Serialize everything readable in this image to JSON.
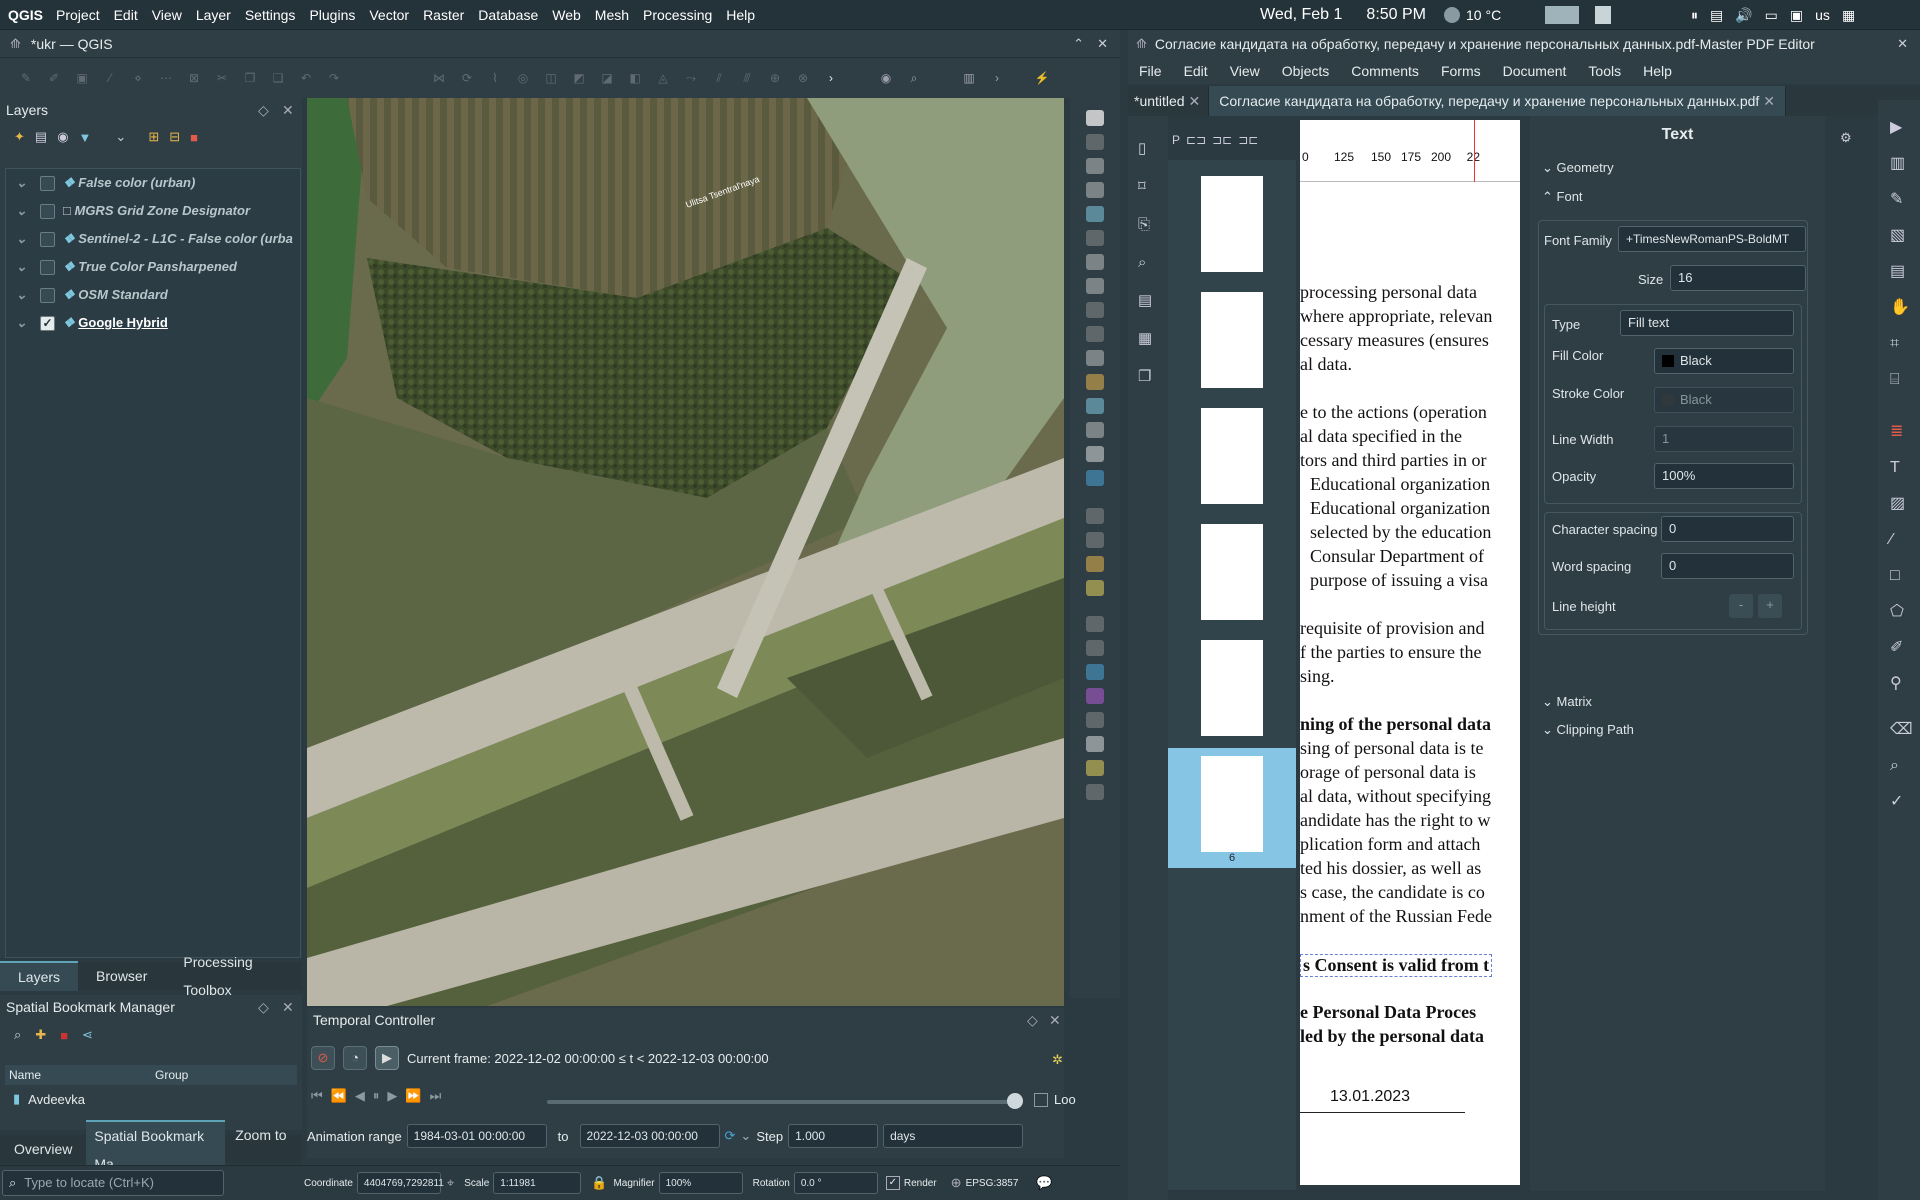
{
  "topbar": {
    "logo": "QGIS",
    "menu": [
      "Project",
      "Edit",
      "View",
      "Layer",
      "Settings",
      "Plugins",
      "Vector",
      "Raster",
      "Database",
      "Web",
      "Mesh",
      "Processing",
      "Help"
    ],
    "date": "Wed, Feb 1",
    "time": "8:50 PM",
    "temp": "10 °C",
    "kbd": "us"
  },
  "qgis": {
    "title": "*ukr — QGIS",
    "layers_title": "Layers",
    "layers": [
      {
        "name": "False color (urban)",
        "checked": false
      },
      {
        "name": "MGRS Grid Zone Designator",
        "checked": false
      },
      {
        "name": "Sentinel-2 - L1C - False color (urba",
        "checked": false
      },
      {
        "name": "True Color Pansharpened",
        "checked": false
      },
      {
        "name": "OSM Standard",
        "checked": false
      },
      {
        "name": "Google Hybrid",
        "checked": true
      }
    ],
    "dock_tabs": [
      "Layers",
      "Browser",
      "Processing Toolbox"
    ],
    "bookmarks_title": "Spatial Bookmark Manager",
    "bm_cols": [
      "Name",
      "Group"
    ],
    "bookmark": "Avdeevka",
    "bottom_tabs": [
      "Overview",
      "Spatial Bookmark Ma...",
      "Zoom to ..."
    ],
    "map_label": "Ulitsa Tsentral'naya",
    "temporal": {
      "title": "Temporal Controller",
      "frame": "Current frame: 2022-12-02 00:00:00 ≤ t < 2022-12-03 00:00:00",
      "range_label": "Animation range",
      "from": "1984-03-01 00:00:00",
      "to_label": "to",
      "to": "2022-12-03 00:00:00",
      "step_label": "Step",
      "step": "1.000",
      "unit": "days",
      "loop": "Loo"
    },
    "status": {
      "locate_placeholder": "Type to locate (Ctrl+K)",
      "coord_label": "Coordinate",
      "coord": "4404769,7292811",
      "scale_label": "Scale",
      "scale": "1:11981",
      "mag_label": "Magnifier",
      "mag": "100%",
      "rot_label": "Rotation",
      "rot": "0.0 °",
      "render": "Render",
      "epsg": "EPSG:3857"
    }
  },
  "pdf": {
    "title": "Согласие кандидата на обработку, передачу и хранение персональных данных.pdf-Master PDF Editor",
    "menu": [
      "File",
      "Edit",
      "View",
      "Objects",
      "Comments",
      "Forms",
      "Document",
      "Tools",
      "Help"
    ],
    "tabs": [
      "*untitled",
      "Согласие кандидата на обработку, передачу и хранение персональных данных.pdf"
    ],
    "ruler": [
      "0",
      "125",
      "150",
      "175",
      "200",
      "22"
    ],
    "thumb_num": "6",
    "lines": [
      "processing personal data",
      "where appropriate, relevan",
      "cessary measures (ensures",
      "al data.",
      "e to the actions (operation",
      "al data specified in the",
      "tors and third parties in or",
      "Educational organization",
      "Educational organization",
      "selected by the education",
      "Consular Department of",
      "purpose of issuing a visa",
      "requisite of provision and",
      "f the parties to ensure the",
      "sing.",
      "ning of the personal data",
      "sing of personal data is te",
      "orage of personal data is",
      "al data, without specifying",
      "andidate has the right to w",
      "plication form and attach",
      "ted his dossier, as well as",
      "s case, the candidate is co",
      "nment of the Russian Fede",
      "s Consent is valid from t",
      "e Personal Data Proces",
      "led by the personal data",
      "13.01.2023"
    ],
    "props": {
      "title": "Text",
      "geometry": "Geometry",
      "font": "Font",
      "font_family_label": "Font Family",
      "font_family": "+TimesNewRomanPS-BoldMT",
      "size_label": "Size",
      "size": "16",
      "type_label": "Type",
      "type": "Fill text",
      "fill_label": "Fill Color",
      "fill": "Black",
      "stroke_label": "Stroke Color",
      "stroke": "Black",
      "lw_label": "Line Width",
      "lw": "1",
      "op_label": "Opacity",
      "op": "100%",
      "cs_label": "Character spacing",
      "cs": "0",
      "ws_label": "Word spacing",
      "ws": "0",
      "lh_label": "Line height",
      "matrix": "Matrix",
      "clip": "Clipping Path"
    }
  }
}
